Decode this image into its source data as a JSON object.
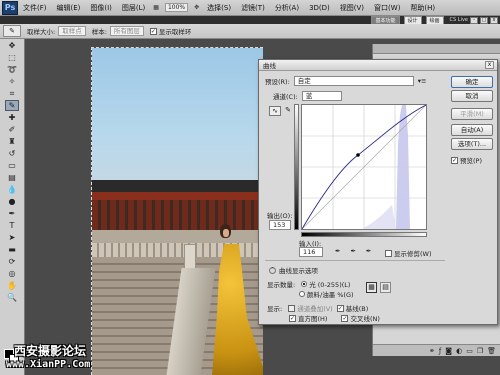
{
  "app": {
    "logo": "Ps",
    "menus": [
      "文件(F)",
      "编辑(E)",
      "图像(I)",
      "图层(L)",
      "选择(S)",
      "滤镜(T)",
      "分析(A)",
      "3D(D)",
      "视图(V)",
      "窗口(W)",
      "帮助(H)"
    ],
    "zoom": "100%",
    "workspace_buttons": [
      "基本功能",
      "设计",
      "绘画"
    ],
    "cs_live": "CS Live",
    "window_controls": [
      "-",
      "□",
      "x"
    ]
  },
  "options_bar": {
    "sample_size_label": "取样大小:",
    "sample_size_value": "取样点",
    "sample_label": "样本:",
    "sample_value": "所有图层",
    "show_ring_label": "显示取样环"
  },
  "curves": {
    "title": "曲线",
    "preset_label": "预设(R):",
    "preset_value": "自定",
    "channel_label": "通道(C):",
    "channel_value": "蓝",
    "output_label": "输出(O):",
    "output_value": "153",
    "input_label": "输入(I):",
    "input_value": "116",
    "show_clipping_label": "显示修剪(W)",
    "curve_options_label": "曲线显示选项",
    "show_amount_label": "显示数量:",
    "light_label": "光 (0-255)(L)",
    "pigment_label": "颜料/油墨 %(G)",
    "show_label": "显示:",
    "channel_overlay_label": "通道叠加(V)",
    "baseline_label": "基线(B)",
    "histogram_label": "直方图(H)",
    "intersection_label": "交叉线(N)",
    "buttons": {
      "ok": "确定",
      "cancel": "取消",
      "smooth": "平滑(M)",
      "auto": "自动(A)",
      "options": "选项(T)...",
      "preview": "预览(P)"
    }
  },
  "watermark": {
    "line1": "西安摄影论坛",
    "line2": "www.XianPP.Com"
  }
}
